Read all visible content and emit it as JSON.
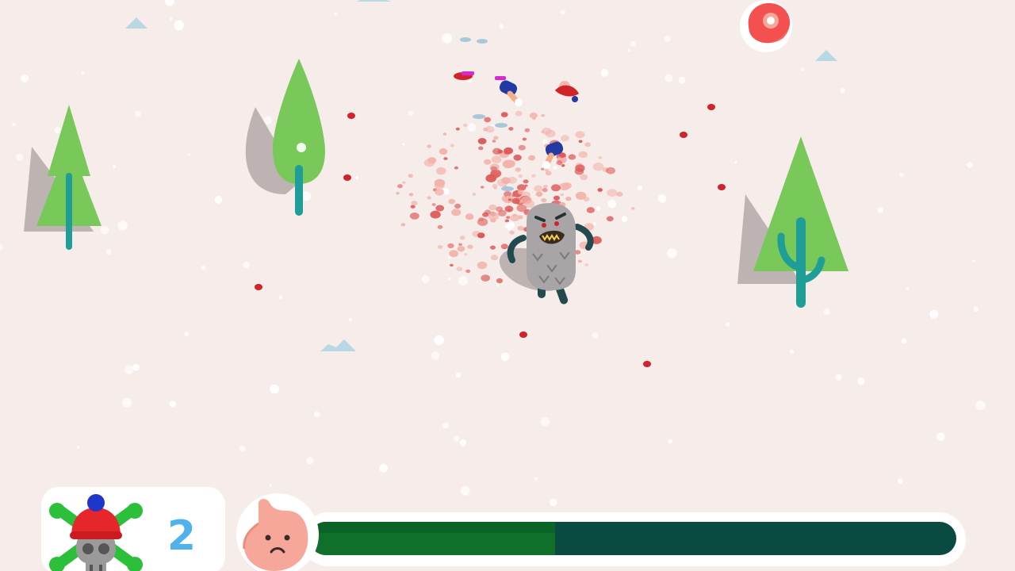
{
  "hud": {
    "kill_count": "2",
    "kills_icon": "skull-with-beanie-and-crossed-bones-icon",
    "hunger_icon": "sad-stomach-icon",
    "hunger_level": 0.38
  },
  "world": {
    "pickup_icon": "steak-meat-icon",
    "player_icon": "grey-yeti-monster",
    "tree_icons": [
      "pine-tree-icon",
      "poplar-tree-icon",
      "pine-tree-with-cactus-icon"
    ],
    "victim_icons": [
      "skier-remains-icon",
      "skier-remains-icon",
      "skier-remains-icon",
      "skier-remains-icon"
    ]
  },
  "colors": {
    "snow": "#f6ece9",
    "tree_green": "#78c85a",
    "trunk_teal": "#1e9e96",
    "blood": "#d0242a",
    "hunger_fill": "#116f2c",
    "hunger_track": "#0a4a40",
    "kill_count": "#4fb2ec",
    "stomach_pink": "#f7a79a"
  }
}
